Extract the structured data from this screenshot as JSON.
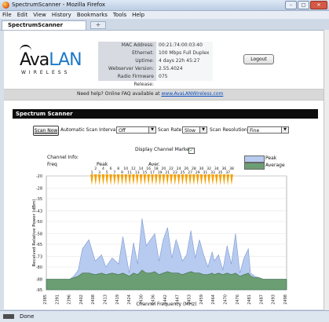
{
  "window": {
    "title": "SpectrumScanner - Mozilla Firefox",
    "tab": "SpectrumScanner",
    "new_tab": "+"
  },
  "menu": [
    "File",
    "Edit",
    "View",
    "History",
    "Bookmarks",
    "Tools",
    "Help"
  ],
  "brand": {
    "name_dark": "Ava",
    "name_blue": "LAN",
    "tagline": "WIRELESS"
  },
  "device_info": [
    {
      "label": "MAC Address:",
      "value": "00:21:74:00:03:40"
    },
    {
      "label": "Ethernet:",
      "value": "100 Mbps Full Duplex"
    },
    {
      "label": "Uptime:",
      "value": "4 days 22h 45:27"
    },
    {
      "label": "Webserver Version:",
      "value": "2.55.4024"
    },
    {
      "label": "Radio Firmware Release:",
      "value": "075"
    }
  ],
  "logout_label": "Logout",
  "help": {
    "text": "Need help?  Online FAQ available at ",
    "link": "www.AvaLANWireless.com"
  },
  "section_title": "Spectrum Scanner",
  "controls": {
    "scan_now": "Scan Now",
    "auto_interval_label": "Automatic Scan Interval:",
    "auto_interval_value": "Off",
    "scan_rate_label": "Scan Rate:",
    "scan_rate_value": "Slow",
    "scan_resolution_label": "Scan Resolution:",
    "scan_resolution_value": "Fine",
    "display_markers_label": "Display Channel Markers:"
  },
  "chart_data": {
    "type": "area",
    "title": "",
    "channel_info_label": "Channel Info:",
    "freq_label": "Freq",
    "peak_label": "Peak",
    "aver_label": "Aver.",
    "xlabel": "Channel Frequency (MHz)",
    "ylabel": "Received Relative Power (dBm)",
    "ylim": [
      -95,
      -20
    ],
    "yticks": [
      -20,
      -28,
      -35,
      -43,
      -50,
      -58,
      -65,
      -73,
      -80,
      -88,
      -95
    ],
    "xlim": [
      2385,
      2498
    ],
    "xticks": [
      "2385",
      "2391",
      "2396",
      "2402",
      "2408",
      "2413",
      "2419",
      "2424",
      "2430",
      "2436",
      "2442",
      "2447",
      "2453",
      "2459",
      "2464",
      "2470",
      "2476",
      "2481",
      "2487",
      "2493",
      "2498"
    ],
    "legend": [
      "Peak",
      "Average"
    ],
    "legend_position": "top-right",
    "colors": {
      "peak": "#b7cbf0",
      "average": "#6b9e73",
      "marker_fill": "#f5a000"
    },
    "channel_markers": [
      "1",
      "2",
      "3",
      "4",
      "5",
      "6",
      "7",
      "8",
      "9",
      "10",
      "11",
      "12",
      "13",
      "14",
      "15",
      "16",
      "17",
      "18",
      "19",
      "20",
      "21",
      "22",
      "23",
      "24",
      "25",
      "26",
      "27",
      "28",
      "29",
      "30",
      "31",
      "32",
      "33",
      "34",
      "35",
      "36",
      "37",
      "38"
    ],
    "series": [
      {
        "name": "Peak",
        "x": [
          2385,
          2391,
          2396,
          2398,
          2400,
          2402,
          2405,
          2408,
          2411,
          2413,
          2416,
          2419,
          2421,
          2424,
          2426,
          2428,
          2430,
          2432,
          2434,
          2436,
          2438,
          2440,
          2442,
          2444,
          2446,
          2447,
          2449,
          2451,
          2453,
          2455,
          2457,
          2459,
          2461,
          2463,
          2464,
          2466,
          2468,
          2470,
          2472,
          2474,
          2476,
          2478,
          2480,
          2481,
          2483,
          2485,
          2487,
          2489,
          2491,
          2493,
          2495,
          2498
        ],
        "values": [
          -88,
          -88,
          -88,
          -86,
          -82,
          -68,
          -62,
          -76,
          -72,
          -80,
          -74,
          -78,
          -60,
          -84,
          -64,
          -78,
          -48,
          -66,
          -62,
          -58,
          -76,
          -62,
          -54,
          -74,
          -62,
          -66,
          -76,
          -72,
          -56,
          -74,
          -62,
          -72,
          -80,
          -70,
          -76,
          -72,
          -82,
          -66,
          -78,
          -58,
          -84,
          -74,
          -68,
          -84,
          -86,
          -87,
          -88,
          -88,
          -88,
          -88,
          -88,
          -88
        ]
      },
      {
        "name": "Average",
        "x": [
          2385,
          2391,
          2396,
          2398,
          2400,
          2402,
          2405,
          2408,
          2411,
          2413,
          2416,
          2419,
          2421,
          2424,
          2426,
          2428,
          2430,
          2432,
          2434,
          2436,
          2438,
          2440,
          2442,
          2444,
          2446,
          2447,
          2449,
          2451,
          2453,
          2455,
          2457,
          2459,
          2461,
          2463,
          2464,
          2466,
          2468,
          2470,
          2472,
          2474,
          2476,
          2478,
          2480,
          2481,
          2483,
          2485,
          2487,
          2489,
          2491,
          2493,
          2495,
          2498
        ],
        "values": [
          -88,
          -88,
          -88,
          -87,
          -86,
          -84,
          -84,
          -85,
          -84,
          -85,
          -84,
          -85,
          -84,
          -86,
          -84,
          -85,
          -82,
          -84,
          -84,
          -83,
          -85,
          -84,
          -83,
          -84,
          -84,
          -84,
          -85,
          -84,
          -83,
          -84,
          -84,
          -85,
          -85,
          -84,
          -85,
          -84,
          -85,
          -84,
          -85,
          -84,
          -86,
          -85,
          -84,
          -86,
          -87,
          -87,
          -88,
          -88,
          -88,
          -88,
          -88,
          -88
        ]
      }
    ]
  },
  "status": {
    "text": "Done"
  }
}
